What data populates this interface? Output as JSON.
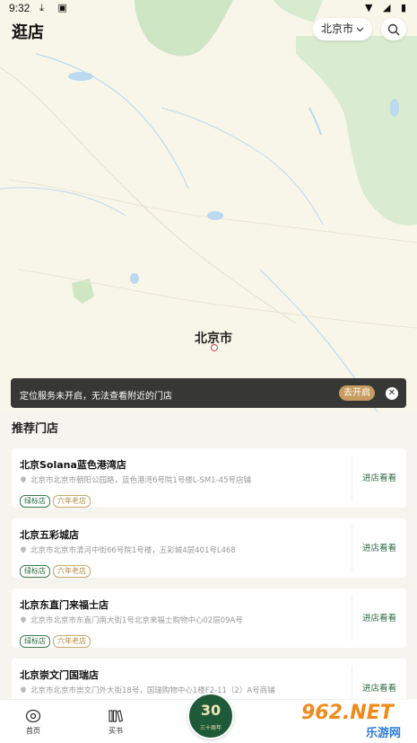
{
  "status_bar": {
    "time": "9:32"
  },
  "header": {
    "title": "逛店",
    "city": "北京市"
  },
  "map": {
    "city_label": "北京市"
  },
  "location_banner": {
    "message": "定位服务未开启，无法查看附近的门店",
    "button": "去开启"
  },
  "section_title": "推荐门店",
  "stores": [
    {
      "name": "北京Solana蓝色港湾店",
      "address": "北京市北京市朝阳公园路，蓝色港湾6号院1号楼L-SM1-45号店铺",
      "tags": [
        "绿标店",
        "六年老店"
      ],
      "action": "进店看看"
    },
    {
      "name": "北京五彩城店",
      "address": "北京市北京市清河中街66号院1号楼，五彩城4层401号L468",
      "tags": [
        "绿标店",
        "六年老店"
      ],
      "action": "进店看看"
    },
    {
      "name": "北京东直门来福士店",
      "address": "北京市北京市东直门南大街1号北京来福士购物中心02层09A号",
      "tags": [
        "绿标店",
        "六年老店"
      ],
      "action": "进店看看"
    },
    {
      "name": "北京崇文门国瑞店",
      "address": "北京市北京市崇文门外大街18号，国瑞购物中心1楼F2-11（2）A号商铺",
      "tags": [],
      "action": "进店看看"
    }
  ],
  "bottom_nav": {
    "home": "首页",
    "buy": "买书",
    "badge_number": "30",
    "badge_text": "三十周年"
  },
  "watermark": {
    "big": "962.NET",
    "small": "乐游网"
  }
}
